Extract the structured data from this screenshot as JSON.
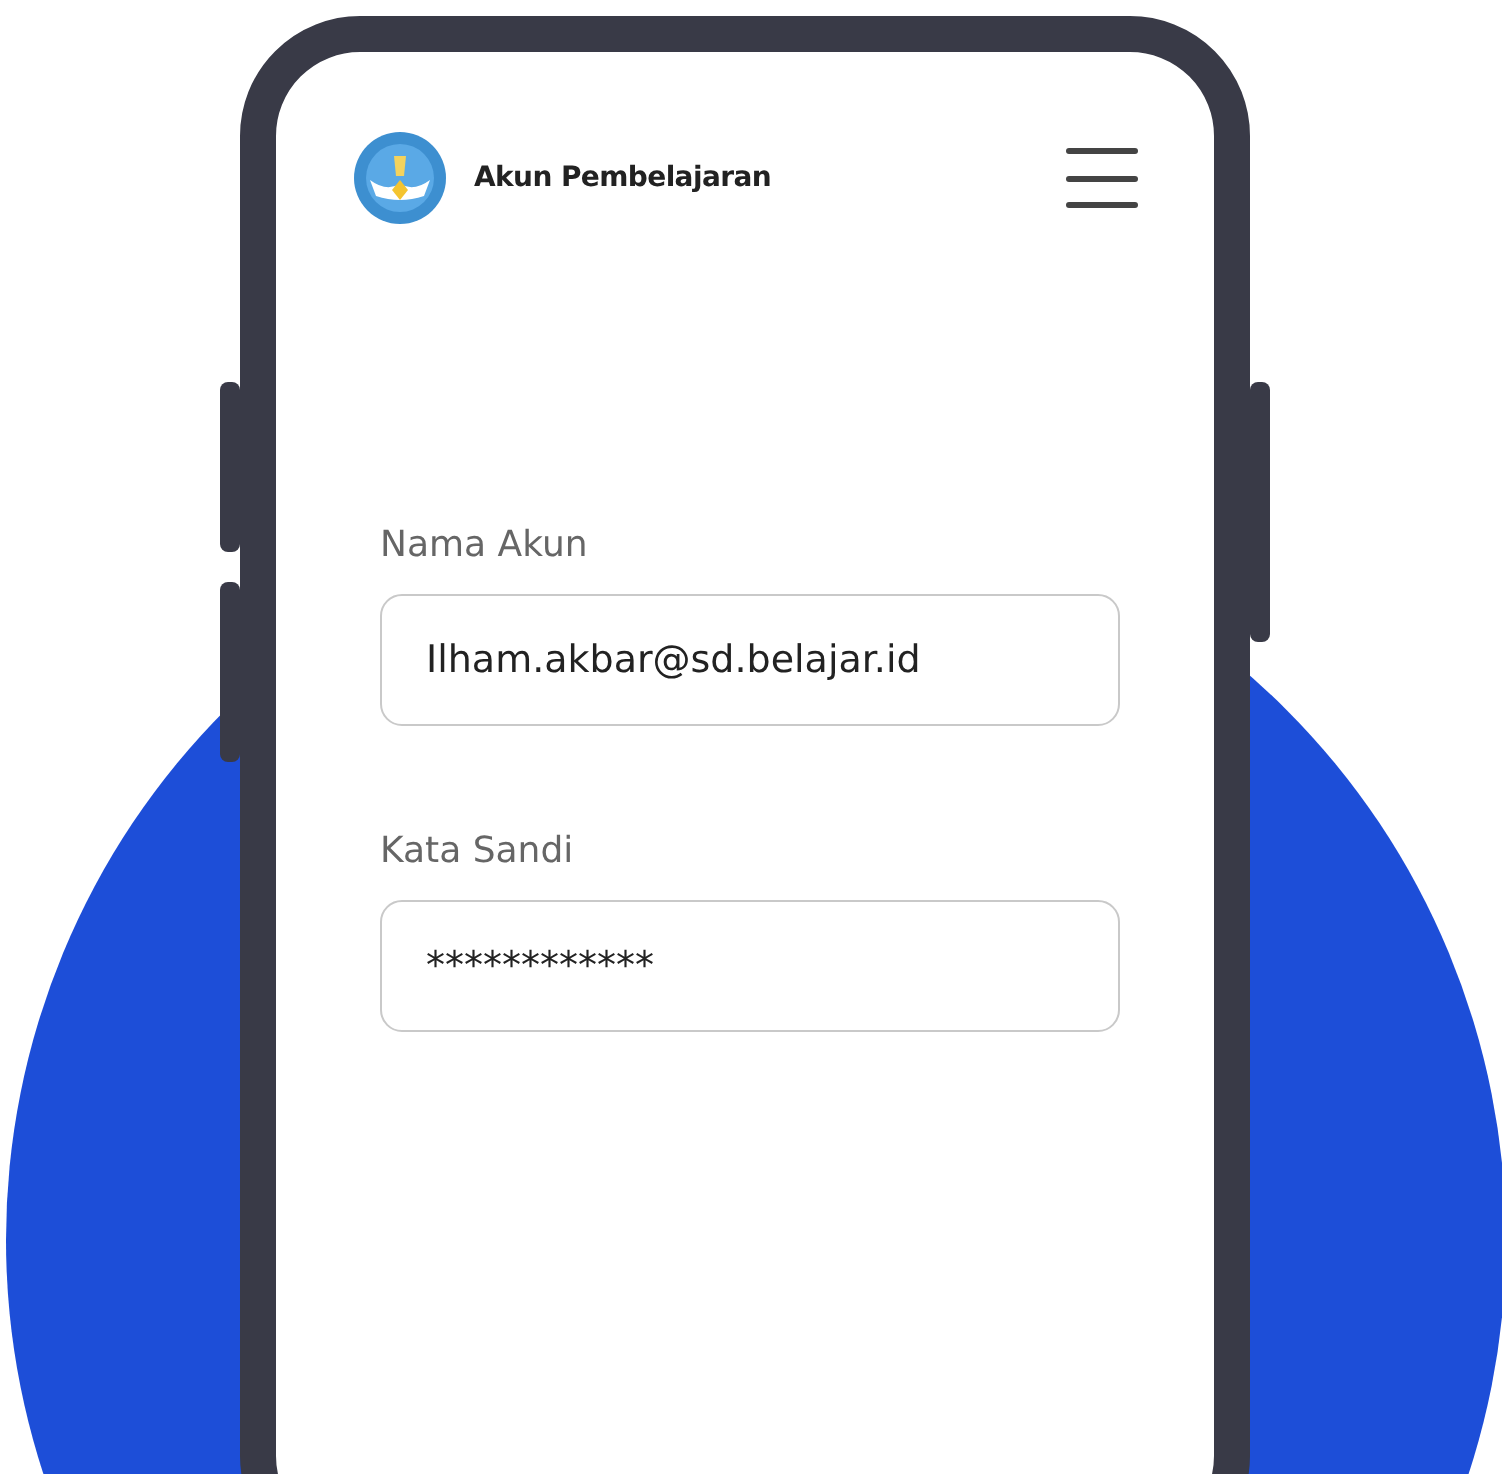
{
  "header": {
    "title": "Akun Pembelajaran"
  },
  "fields": [
    {
      "label": "Nama Akun",
      "value": "Ilham.akbar@sd.belajar.id"
    },
    {
      "label": "Kata Sandi",
      "value": "************"
    }
  ]
}
